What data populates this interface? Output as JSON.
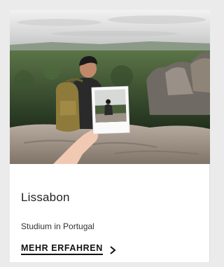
{
  "card": {
    "image_alt": "Person on a rocky hilltop holding a polaroid photo",
    "title": "Lissabon",
    "subtitle": "Studium in Portugal",
    "cta_label": "MEHR ERFAHREN",
    "cta_icon": "chevron-right-icon"
  }
}
